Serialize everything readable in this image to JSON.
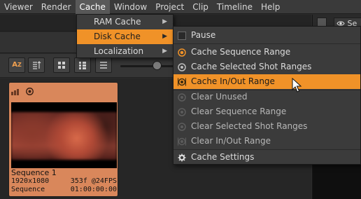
{
  "menubar": {
    "items": [
      {
        "label": "Viewer"
      },
      {
        "label": "Render"
      },
      {
        "label": "Cache",
        "active": true
      },
      {
        "label": "Window"
      },
      {
        "label": "Project"
      },
      {
        "label": "Clip"
      },
      {
        "label": "Timeline"
      },
      {
        "label": "Help"
      }
    ]
  },
  "cache_menu": {
    "items": [
      {
        "label": "RAM Cache",
        "has_submenu": true
      },
      {
        "label": "Disk Cache",
        "has_submenu": true,
        "highlighted": true
      },
      {
        "label": "Localization",
        "has_submenu": true
      }
    ]
  },
  "disk_cache_menu": {
    "items": [
      {
        "label": "Pause",
        "icon": "checkbox-icon"
      },
      {
        "label": "Cache Sequence Range",
        "icon": "cache-sequence-icon"
      },
      {
        "label": "Cache Selected Shot Ranges",
        "icon": "cache-shots-icon"
      },
      {
        "label": "Cache In/Out Range",
        "icon": "cache-inout-icon",
        "highlighted": true
      },
      {
        "label": "Clear Unused",
        "icon": "clear-unused-icon"
      },
      {
        "label": "Clear Sequence Range",
        "icon": "clear-sequence-icon"
      },
      {
        "label": "Clear Selected Shot Ranges",
        "icon": "clear-shots-icon"
      },
      {
        "label": "Clear In/Out Range",
        "icon": "clear-inout-icon"
      },
      {
        "label": "Cache Settings",
        "icon": "gear-icon"
      }
    ]
  },
  "toolbar": {
    "sort_label": "A",
    "sort_sub": "Z"
  },
  "clip": {
    "name": "Sequence 1",
    "resolution": "1920x1080",
    "frames_fps": "353f @24FPS",
    "type": "Sequence",
    "timecode": "01:00:00:00"
  },
  "right_panel": {
    "tab_label": "Se"
  },
  "colors": {
    "highlight": "#f09228",
    "card": "#d9875b"
  }
}
